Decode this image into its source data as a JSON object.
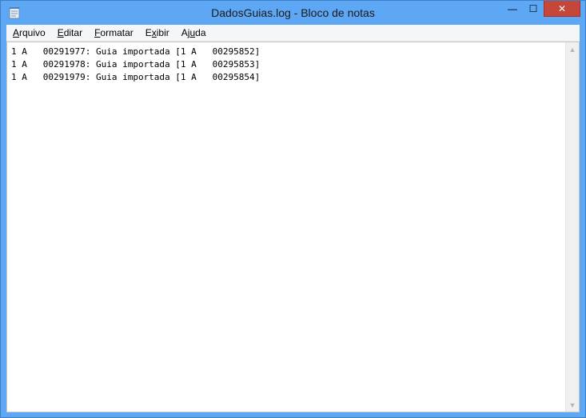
{
  "window": {
    "title": "DadosGuias.log - Bloco de notas",
    "app_icon": "notepad-icon",
    "buttons": {
      "minimize_glyph": "—",
      "maximize_glyph": "☐",
      "close_glyph": "✕"
    },
    "accent": "#5ea7f4",
    "close_color": "#c7463a"
  },
  "menu": {
    "items": [
      {
        "prefix": "",
        "accel": "A",
        "rest": "rquivo"
      },
      {
        "prefix": "",
        "accel": "E",
        "rest": "ditar"
      },
      {
        "prefix": "",
        "accel": "F",
        "rest": "ormatar"
      },
      {
        "prefix": "E",
        "accel": "x",
        "rest": "ibir"
      },
      {
        "prefix": "Aj",
        "accel": "u",
        "rest": "da"
      }
    ]
  },
  "document": {
    "lines": [
      "1 A   00291977: Guia importada [1 A   00295852]",
      "1 A   00291978: Guia importada [1 A   00295853]",
      "1 A   00291979: Guia importada [1 A   00295854]"
    ]
  },
  "scrollbar": {
    "up_glyph": "▲",
    "down_glyph": "▼"
  }
}
